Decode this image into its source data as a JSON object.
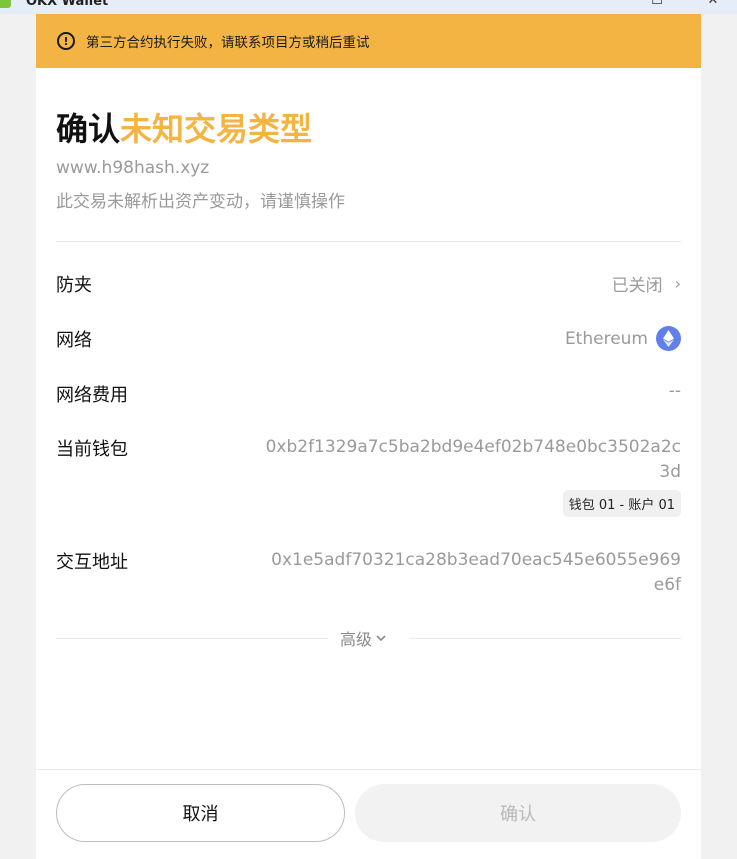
{
  "window": {
    "title": "OKX Wallet"
  },
  "warning": {
    "text": "第三方合约执行失败，请联系项目方或稍后重试"
  },
  "header": {
    "title_prefix": "确认",
    "title_accent": "未知交易类型",
    "site": "www.h98hash.xyz",
    "subtitle": "此交易未解析出资产变动，请谨慎操作"
  },
  "rows": {
    "anti_sandwich": {
      "label": "防夹",
      "value": "已关闭"
    },
    "network": {
      "label": "网络",
      "value": "Ethereum",
      "icon": "ethereum-icon"
    },
    "network_fee": {
      "label": "网络费用",
      "value": "--"
    },
    "current_wallet": {
      "label": "当前钱包",
      "address": "0xb2f1329a7c5ba2bd9e4ef02b748e0bc3502a2c3d",
      "badge": "钱包 01 - 账户 01"
    },
    "interact_address": {
      "label": "交互地址",
      "address": "0x1e5adf70321ca28b3ead70eac545e6055e969e6f"
    }
  },
  "advanced": {
    "label": "高级"
  },
  "buttons": {
    "cancel": "取消",
    "confirm": "确认"
  },
  "colors": {
    "warning_bg": "#f3b443",
    "accent": "#f3b443",
    "eth": "#627eea"
  }
}
